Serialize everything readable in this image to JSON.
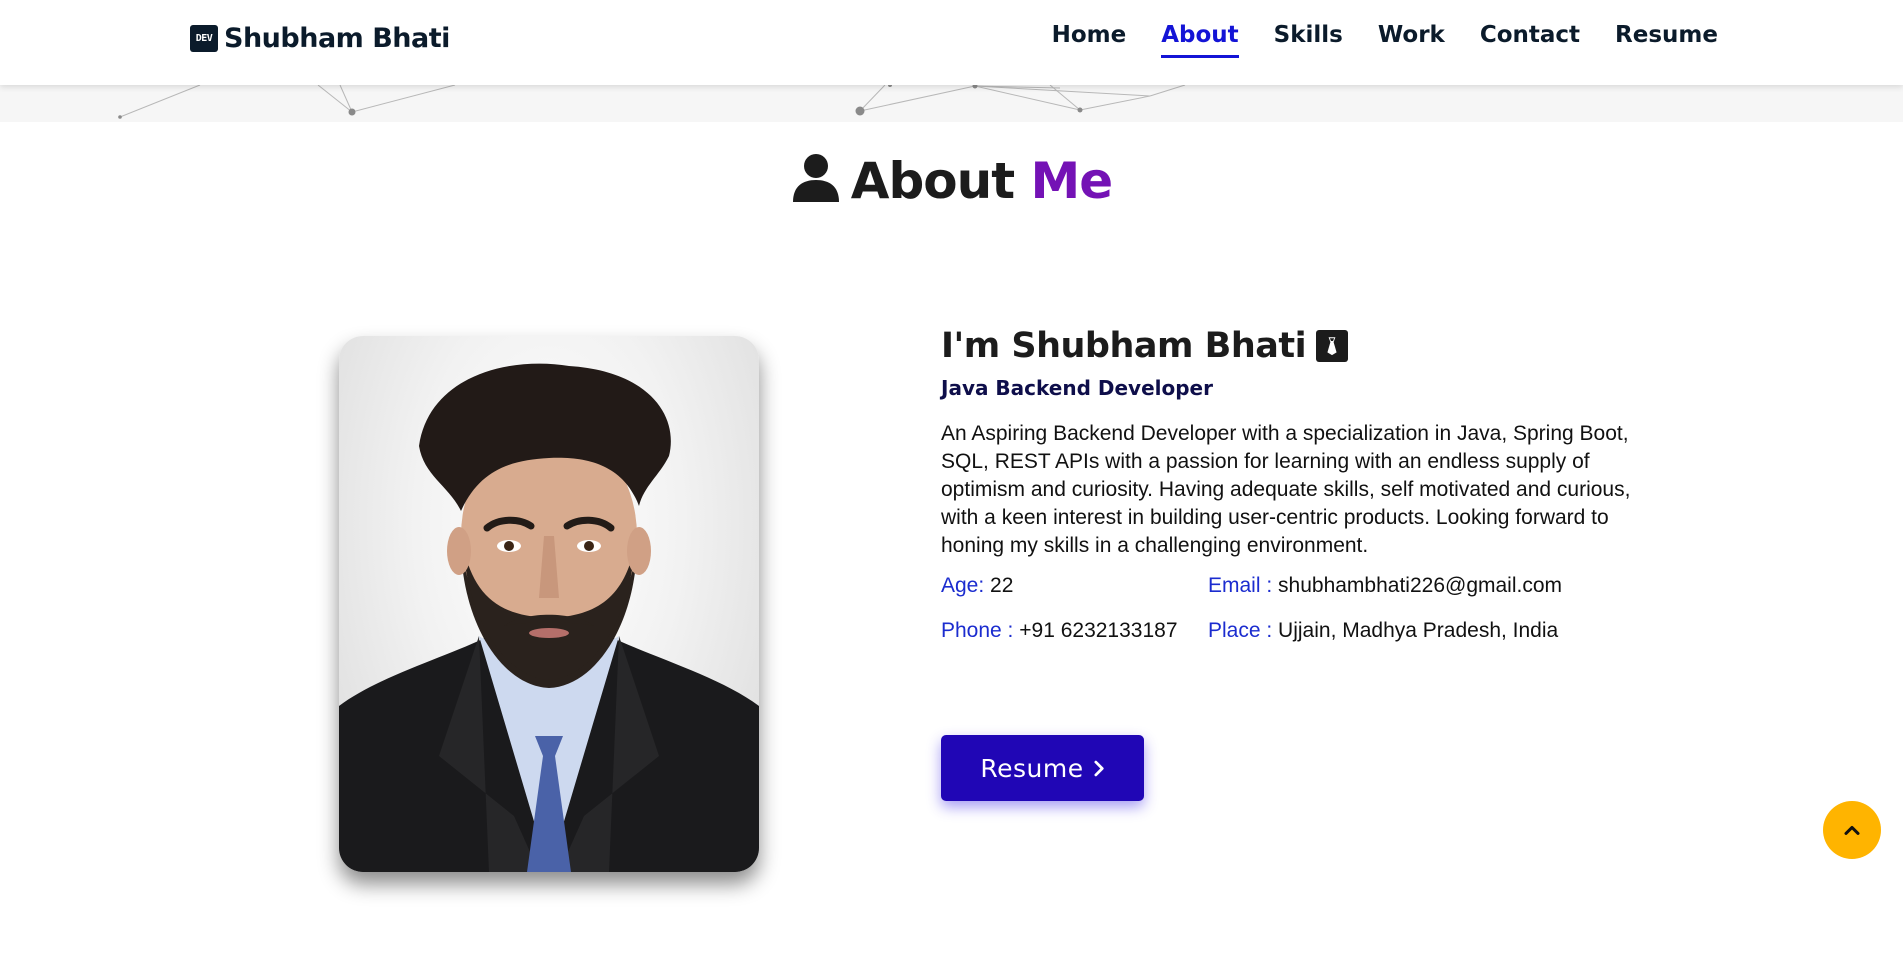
{
  "navbar": {
    "brand_icon_text": "DEV",
    "brand_name": "Shubham Bhati",
    "items": [
      {
        "label": "Home",
        "active": false
      },
      {
        "label": "About",
        "active": true
      },
      {
        "label": "Skills",
        "active": false
      },
      {
        "label": "Work",
        "active": false
      },
      {
        "label": "Contact",
        "active": false
      },
      {
        "label": "Resume",
        "active": false
      }
    ]
  },
  "section": {
    "title_main": "About",
    "title_accent": "Me",
    "icon": "user-icon"
  },
  "about": {
    "greeting": "I'm Shubham Bhati",
    "greeting_icon": "tie-icon",
    "role": "Java Backend Developer",
    "description": "An Aspiring Backend Developer with a specialization in Java, Spring Boot, SQL, REST APIs with a passion for learning with an endless supply of optimism and curiosity. Having adequate skills, self motivated and curious, with a keen interest in building user-centric products. Looking forward to honing my skills in a challenging environment.",
    "info": {
      "age_label": "Age:",
      "age_value": "22",
      "email_label": "Email :",
      "email_value": "shubhambhati226@gmail.com",
      "phone_label": "Phone :",
      "phone_value": "+91 6232133187",
      "place_label": "Place :",
      "place_value": "Ujjain, Madhya Pradesh, India"
    },
    "resume_button": "Resume",
    "resume_icon": "chevron-right-icon"
  },
  "scroll_top_icon": "chevron-up-icon",
  "colors": {
    "accent_purple": "#7412b5",
    "nav_active": "#1414d6",
    "button_bg": "#2006b5",
    "info_label": "#1b2ccf",
    "scroll_top_bg": "#ffb400"
  }
}
